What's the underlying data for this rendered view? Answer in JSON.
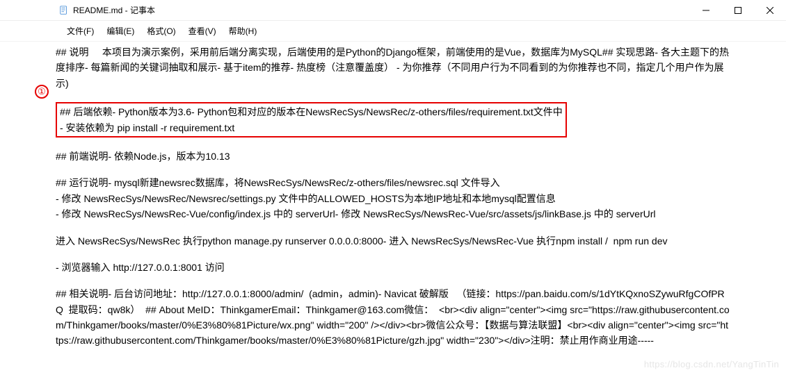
{
  "titlebar": {
    "title": "README.md - 记事本"
  },
  "menubar": {
    "items": [
      {
        "label": "文件(F)"
      },
      {
        "label": "编辑(E)"
      },
      {
        "label": "格式(O)"
      },
      {
        "label": "查看(V)"
      },
      {
        "label": "帮助(H)"
      }
    ]
  },
  "annotation": {
    "badge": "①"
  },
  "content": {
    "p1": "## 说明     本项目为演示案例，采用前后端分离实现，后端使用的是Python的Django框架，前端使用的是Vue，数据库为MySQL## 实现思路- 各大主题下的热度排序- 每篇新闻的关键词抽取和展示- 基于item的推荐- 热度榜（注意覆盖度） - 为你推荐（不同用户行为不同看到的为你推荐也不同，指定几个用户作为展示)",
    "p2_l1": "## 后端依赖- Python版本为3.6- Python包和对应的版本在NewsRecSys/NewsRec/z-others/files/requirement.txt文件中",
    "p2_l2": "- 安装依赖为 pip install -r requirement.txt",
    "p3": "## 前端说明- 依赖Node.js，版本为10.13",
    "p4": "## 运行说明- mysql新建newsrec数据库，将NewsRecSys/NewsRec/z-others/files/newsrec.sql 文件导入\n- 修改 NewsRecSys/NewsRec/Newsrec/settings.py 文件中的ALLOWED_HOSTS为本地IP地址和本地mysql配置信息\n- 修改 NewsRecSys/NewsRec-Vue/config/index.js 中的 serverUrl- 修改 NewsRecSys/NewsRec-Vue/src/assets/js/linkBase.js 中的 serverUrl",
    "p5": "进入 NewsRecSys/NewsRec 执行python manage.py runserver 0.0.0.0:8000- 进入 NewsRecSys/NewsRec-Vue 执行npm install /  npm run dev",
    "p6": "- 浏览器输入 http://127.0.0.1:8001 访问",
    "p7": "## 相关说明- 后台访问地址：http://127.0.0.1:8000/admin/  (admin，admin)- Navicat 破解版   （链接：https://pan.baidu.com/s/1dYtKQxnoSZywuRfgCOfPRQ  提取码：qw8k）  ## About MeID：ThinkgamerEmail：Thinkgamer@163.com微信：  <br><div align=\"center\"><img src=\"https://raw.githubusercontent.com/Thinkgamer/books/master/0%E3%80%81Picture/wx.png\" width=\"200\" /></div><br>微信公众号：【数据与算法联盟】<br><div align=\"center\"><img src=\"https://raw.githubusercontent.com/Thinkgamer/books/master/0%E3%80%81Picture/gzh.jpg\" width=\"230\"></div>注明：禁止用作商业用途-----"
  },
  "watermark": "https://blog.csdn.net/YangTinTin"
}
